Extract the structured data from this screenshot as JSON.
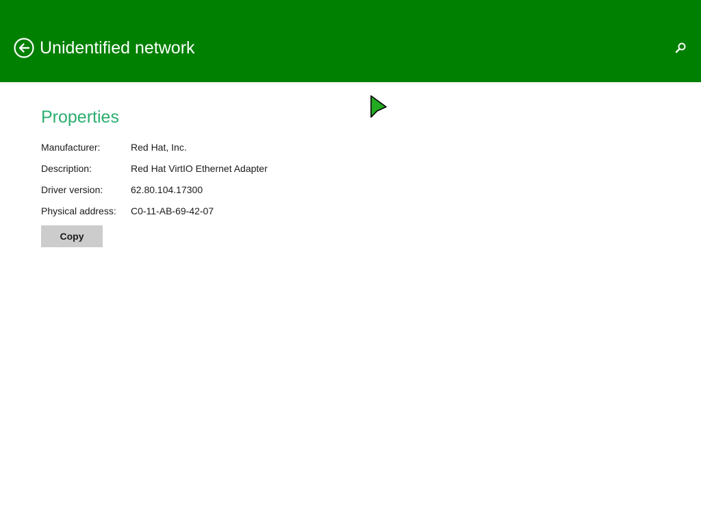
{
  "window": {
    "title": "Unidentified network"
  },
  "header": {
    "title": "Unidentified network",
    "back_icon": "back-arrow-circle-icon",
    "search_icon": "search-icon",
    "background_color": "#008000"
  },
  "properties": {
    "section_title": "Properties",
    "accent_color": "#2aae6e",
    "rows": [
      {
        "label": "Manufacturer:",
        "value": "Red Hat, Inc."
      },
      {
        "label": "Description:",
        "value": "Red Hat VirtIO Ethernet Adapter"
      },
      {
        "label": "Driver version:",
        "value": "62.80.104.17300"
      },
      {
        "label": "Physical address:",
        "value": "C0-11-AB-69-42-07"
      }
    ],
    "copy_label": "Copy"
  },
  "cursor": {
    "icon": "mouse-pointer-icon",
    "color": "#22aa22"
  }
}
